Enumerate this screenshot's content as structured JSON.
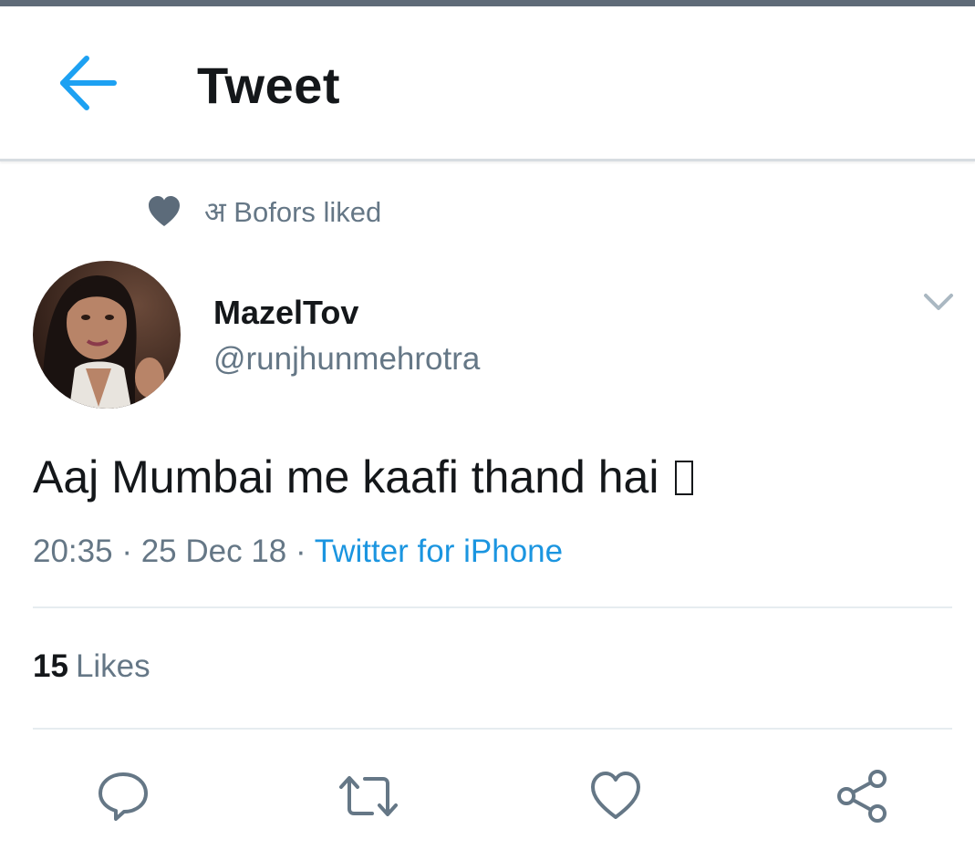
{
  "header": {
    "title": "Tweet",
    "back_icon": "arrow-left-icon"
  },
  "social_context": {
    "icon": "heart-filled-icon",
    "text": "अ Bofors liked"
  },
  "author": {
    "name": "MazelTov",
    "handle": "@runjhunmehrotra"
  },
  "tweet": {
    "text": "Aaj Mumbai me kaafi thand hai",
    "time": "20:35",
    "separator": "·",
    "date": "25 Dec 18",
    "source": "Twitter for iPhone"
  },
  "stats": {
    "likes_count": "15",
    "likes_label": "Likes"
  },
  "actions": {
    "reply_icon": "reply-icon",
    "retweet_icon": "retweet-icon",
    "like_icon": "heart-outline-icon",
    "share_icon": "share-icon"
  },
  "colors": {
    "accent": "#1da1f2",
    "link": "#1b95e0",
    "secondary_text": "#657786",
    "primary_text": "#14171a",
    "divider": "#e6ecf0"
  }
}
